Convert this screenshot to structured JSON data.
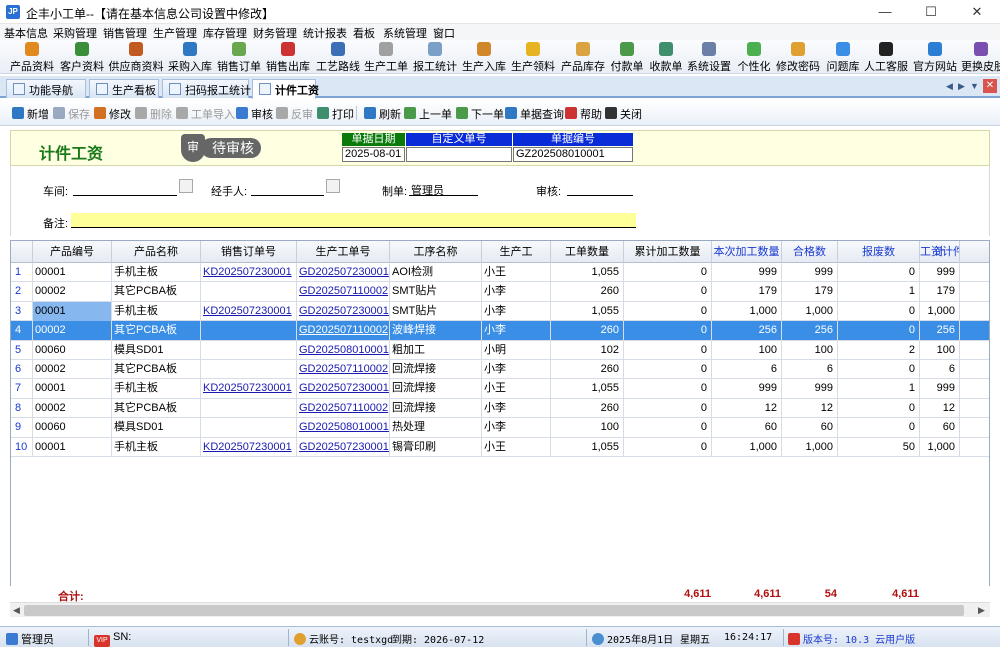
{
  "window": {
    "title": "企丰小工单--【请在基本信息公司设置中修改】",
    "app_icon": "JP"
  },
  "menu": [
    "基本信息",
    "采购管理",
    "销售管理",
    "生产管理",
    "库存管理",
    "财务管理",
    "统计报表",
    "看板",
    "系统管理",
    "窗口"
  ],
  "toolbar": [
    {
      "label": "产品资料",
      "icon": "product-icon",
      "color": "#e08a1e"
    },
    {
      "label": "客户资料",
      "icon": "customer-icon",
      "color": "#3b8f3b"
    },
    {
      "label": "供应商资料",
      "icon": "supplier-icon",
      "color": "#c05a20"
    },
    {
      "label": "采购入库",
      "icon": "purchase-icon",
      "color": "#2f78c4"
    },
    {
      "label": "销售订单",
      "icon": "sales-order-icon",
      "color": "#6aa84f"
    },
    {
      "label": "销售出库",
      "icon": "sales-out-icon",
      "color": "#cc3333"
    },
    {
      "label": "工艺路线",
      "icon": "process-route-icon",
      "color": "#3d6fb6"
    },
    {
      "label": "生产工单",
      "icon": "work-order-icon",
      "color": "#a0a0a0"
    },
    {
      "label": "报工统计",
      "icon": "report-stats-icon",
      "color": "#7aa0c8"
    },
    {
      "label": "生产入库",
      "icon": "production-in-icon",
      "color": "#d0882a"
    },
    {
      "label": "生产领料",
      "icon": "material-pick-icon",
      "color": "#e6b422"
    },
    {
      "label": "产品库存",
      "icon": "inventory-icon",
      "color": "#d9a441"
    },
    {
      "label": "付款单",
      "icon": "payment-icon",
      "color": "#4a9a4a"
    },
    {
      "label": "收款单",
      "icon": "receipt-icon",
      "color": "#3f8f6f"
    },
    {
      "label": "系统设置",
      "icon": "settings-icon",
      "color": "#6b7fa8"
    },
    {
      "label": "个性化",
      "icon": "personalize-icon",
      "color": "#4caf50"
    },
    {
      "label": "修改密码",
      "icon": "password-icon",
      "color": "#e0a030"
    },
    {
      "label": "问题库",
      "icon": "faq-icon",
      "color": "#3a8ee6"
    },
    {
      "label": "人工客服",
      "icon": "support-icon",
      "color": "#222222"
    },
    {
      "label": "官方网站",
      "icon": "website-icon",
      "color": "#2a7fd4"
    },
    {
      "label": "更换皮肤",
      "icon": "skin-icon",
      "color": "#7a4fb0"
    }
  ],
  "tabs": [
    {
      "label": "功能导航",
      "active": false
    },
    {
      "label": "生产看板",
      "active": false
    },
    {
      "label": "扫码报工统计",
      "active": false
    },
    {
      "label": "计件工资",
      "active": true
    }
  ],
  "actions": [
    {
      "label": "新增",
      "icon": "add-icon",
      "color": "#2f78c4",
      "enabled": true
    },
    {
      "label": "保存",
      "icon": "save-icon",
      "color": "#9aa9bf",
      "enabled": false
    },
    {
      "label": "修改",
      "icon": "edit-icon",
      "color": "#d07020",
      "enabled": true
    },
    {
      "label": "删除",
      "icon": "delete-icon",
      "color": "#a8a8a8",
      "enabled": false
    },
    {
      "label": "工单导入",
      "icon": "import-icon",
      "color": "#a8a8a8",
      "enabled": false
    },
    {
      "label": "审核",
      "icon": "approve-icon",
      "color": "#3a7ad0",
      "enabled": true
    },
    {
      "label": "反审",
      "icon": "unapprove-icon",
      "color": "#a8a8a8",
      "enabled": false
    },
    {
      "label": "打印",
      "icon": "print-icon",
      "color": "#3f8f6f",
      "enabled": true
    },
    {
      "label": "刷新",
      "icon": "refresh-icon",
      "color": "#2f78c4",
      "enabled": true
    },
    {
      "label": "上一单",
      "icon": "prev-icon",
      "color": "#4a9a4a",
      "enabled": true
    },
    {
      "label": "下一单",
      "icon": "next-icon",
      "color": "#4a9a4a",
      "enabled": true
    },
    {
      "label": "单据查询",
      "icon": "query-icon",
      "color": "#2f78c4",
      "enabled": true
    },
    {
      "label": "帮助",
      "icon": "help-icon",
      "color": "#cc3333",
      "enabled": true
    },
    {
      "label": "关闭",
      "icon": "close-icon",
      "color": "#333333",
      "enabled": true
    }
  ],
  "doc": {
    "title": "计件工资",
    "stamp_symbol": "审",
    "stamp_text": "待审核",
    "date_label": "单据日期",
    "date_value": "2025-08-01",
    "custom_no_label": "自定义单号",
    "custom_no_value": "",
    "doc_no_label": "单据编号",
    "doc_no_value": "GZ202508010001"
  },
  "form": {
    "workshop_label": "车间:",
    "workshop_value": "",
    "handler_label": "经手人:",
    "handler_value": "",
    "creator_label": "制单:",
    "creator_value": "管理员",
    "reviewer_label": "审核:",
    "reviewer_value": "",
    "remark_label": "备注:",
    "remark_value": ""
  },
  "grid": {
    "columns": [
      "产品编号",
      "产品名称",
      "销售订单号",
      "生产工单号",
      "工序名称",
      "生产工",
      "工单数量",
      "累计加工数量",
      "本次加工数量",
      "合格数",
      "报废数",
      "工资计件数量",
      "计"
    ],
    "rows": [
      {
        "idx": "1",
        "code": "00001",
        "name": "手机主板",
        "so": "KD202507230001",
        "wo": "GD202507230001",
        "proc": "AOI检测",
        "worker": "小王",
        "qty": "1,055",
        "cum": "0",
        "cur": "999",
        "good": "999",
        "scrap": "0",
        "pay": "999"
      },
      {
        "idx": "2",
        "code": "00002",
        "name": "其它PCBA板",
        "so": "",
        "wo": "GD202507110002",
        "proc": "SMT贴片",
        "worker": "小李",
        "qty": "260",
        "cum": "0",
        "cur": "179",
        "good": "179",
        "scrap": "1",
        "pay": "179"
      },
      {
        "idx": "3",
        "code": "00001",
        "name": "手机主板",
        "so": "KD202507230001",
        "wo": "GD202507230001",
        "proc": "SMT贴片",
        "worker": "小李",
        "qty": "1,055",
        "cum": "0",
        "cur": "1,000",
        "good": "1,000",
        "scrap": "0",
        "pay": "1,000"
      },
      {
        "idx": "4",
        "code": "00002",
        "name": "其它PCBA板",
        "so": "",
        "wo": "GD202507110002",
        "proc": "波峰焊接",
        "worker": "小李",
        "qty": "260",
        "cum": "0",
        "cur": "256",
        "good": "256",
        "scrap": "0",
        "pay": "256"
      },
      {
        "idx": "5",
        "code": "00060",
        "name": "模具SD01",
        "so": "",
        "wo": "GD202508010001",
        "proc": "粗加工",
        "worker": "小明",
        "qty": "102",
        "cum": "0",
        "cur": "100",
        "good": "100",
        "scrap": "2",
        "pay": "100"
      },
      {
        "idx": "6",
        "code": "00002",
        "name": "其它PCBA板",
        "so": "",
        "wo": "GD202507110002",
        "proc": "回流焊接",
        "worker": "小李",
        "qty": "260",
        "cum": "0",
        "cur": "6",
        "good": "6",
        "scrap": "0",
        "pay": "6"
      },
      {
        "idx": "7",
        "code": "00001",
        "name": "手机主板",
        "so": "KD202507230001",
        "wo": "GD202507230001",
        "proc": "回流焊接",
        "worker": "小王",
        "qty": "1,055",
        "cum": "0",
        "cur": "999",
        "good": "999",
        "scrap": "1",
        "pay": "999"
      },
      {
        "idx": "8",
        "code": "00002",
        "name": "其它PCBA板",
        "so": "",
        "wo": "GD202507110002",
        "proc": "回流焊接",
        "worker": "小李",
        "qty": "260",
        "cum": "0",
        "cur": "12",
        "good": "12",
        "scrap": "0",
        "pay": "12"
      },
      {
        "idx": "9",
        "code": "00060",
        "name": "模具SD01",
        "so": "",
        "wo": "GD202508010001",
        "proc": "热处理",
        "worker": "小李",
        "qty": "100",
        "cum": "0",
        "cur": "60",
        "good": "60",
        "scrap": "0",
        "pay": "60"
      },
      {
        "idx": "10",
        "code": "00001",
        "name": "手机主板",
        "so": "KD202507230001",
        "wo": "GD202507230001",
        "proc": "锡膏印刷",
        "worker": "小王",
        "qty": "1,055",
        "cum": "0",
        "cur": "1,000",
        "good": "1,000",
        "scrap": "50",
        "pay": "1,000"
      }
    ],
    "selected_index": 3,
    "totals": {
      "label": "合计:",
      "cur": "4,611",
      "good": "4,611",
      "scrap": "54",
      "pay": "4,611"
    }
  },
  "status": {
    "user": "管理员",
    "sn_label": "SN:",
    "vip_badge": "VIP",
    "cloud_label": "云账号: testxgd",
    "expire_label": "到期: 2026-07-12",
    "date": "2025年8月1日",
    "weekday": "星期五",
    "time": "16:24:17",
    "version": "版本号: 10.3 云用户版"
  }
}
